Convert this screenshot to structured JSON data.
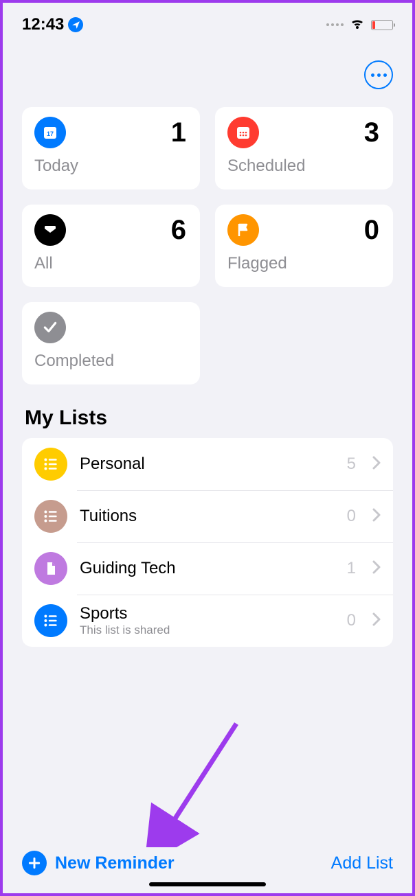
{
  "status_bar": {
    "time": "12:43"
  },
  "summary": {
    "today": {
      "label": "Today",
      "count": 1
    },
    "scheduled": {
      "label": "Scheduled",
      "count": 3
    },
    "all": {
      "label": "All",
      "count": 6
    },
    "flagged": {
      "label": "Flagged",
      "count": 0
    },
    "completed": {
      "label": "Completed"
    }
  },
  "lists_header": "My Lists",
  "lists": [
    {
      "name": "Personal",
      "count": 5,
      "color": "#FFCC00",
      "icon": "list"
    },
    {
      "name": "Tuitions",
      "count": 0,
      "color": "#C69C8E",
      "icon": "list"
    },
    {
      "name": "Guiding Tech",
      "count": 1,
      "color": "#BF7AE0",
      "icon": "file"
    },
    {
      "name": "Sports",
      "count": 0,
      "color": "#007AFF",
      "icon": "list",
      "subtitle": "This list is shared"
    }
  ],
  "toolbar": {
    "new_reminder": "New Reminder",
    "add_list": "Add List"
  }
}
